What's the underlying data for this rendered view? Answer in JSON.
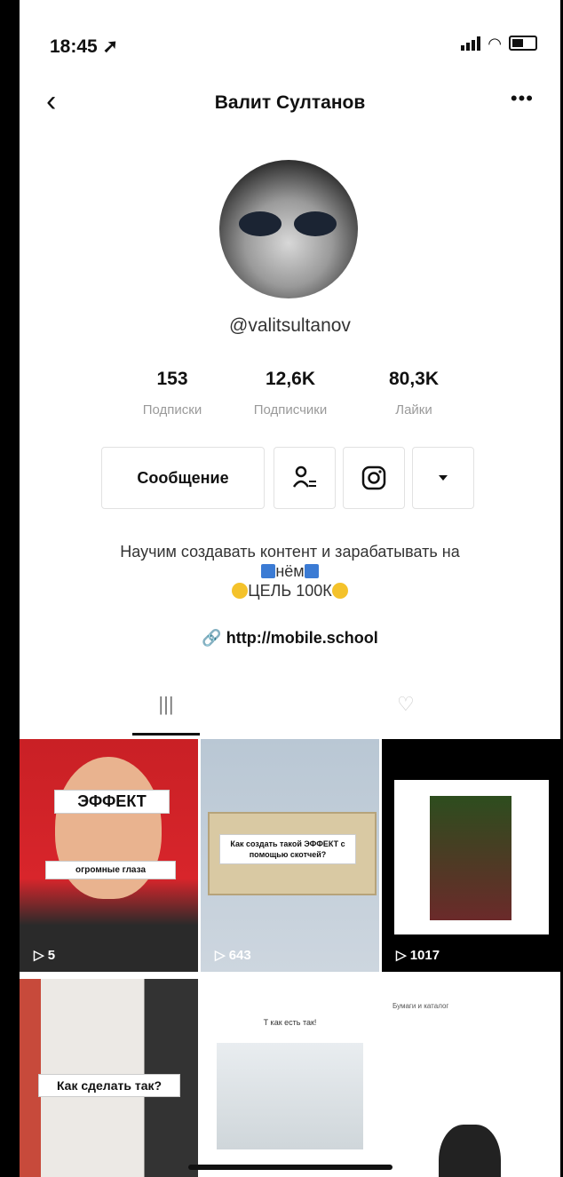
{
  "status": {
    "time": "18:45 ➚"
  },
  "header": {
    "back": "‹",
    "title": "Валит Султанов",
    "more": "•••"
  },
  "profile": {
    "handle": "@valitsultanov",
    "stats": [
      {
        "value": "153",
        "label": "Подписки"
      },
      {
        "value": "12,6K",
        "label": "Подписчики"
      },
      {
        "value": "80,3K",
        "label": "Лайки"
      }
    ],
    "message_button": "Сообщение",
    "bio_line1": "Научим создавать контент и зарабатывать на",
    "bio_line2": "нём",
    "bio_line3": "ЦЕЛЬ 100К",
    "link": "http://mobile.school"
  },
  "videos": [
    {
      "overlay_title": "ЭФФЕКТ",
      "overlay_sub": "огромные глаза",
      "views": "5"
    },
    {
      "overlay_title": "Как создать такой ЭФФЕКТ с помощью скотчей?",
      "views": "643"
    },
    {
      "views": "1017"
    },
    {
      "overlay_title": "Как сделать так?"
    },
    {
      "overlay_title": "Т как есть так!"
    },
    {
      "overlay_title": "Бумаги и каталог"
    }
  ]
}
